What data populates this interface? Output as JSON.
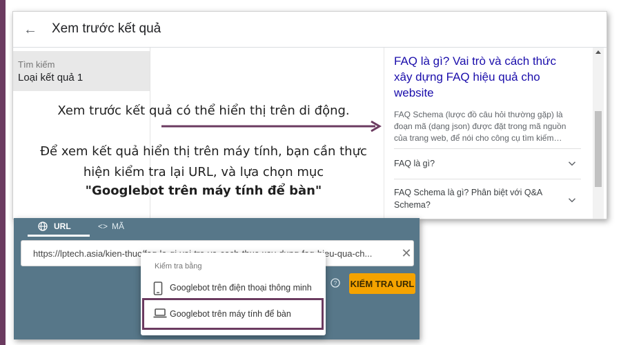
{
  "header": {
    "title": "Xem trước kết quả"
  },
  "sidebar": {
    "label": "Tìm kiếm",
    "value": "Loại kết quả 1"
  },
  "result": {
    "title": "FAQ là gì? Vai trò và cách thức xây dựng FAQ hiệu quả cho website",
    "snippet": "FAQ Schema (lược đồ câu hỏi thường gặp) là đoạn mã (dạng json) được đặt trong mã nguồn của trang web, để nói cho công cụ tìm kiếm…",
    "faqs": [
      "FAQ là gì?",
      "FAQ Schema là gì? Phân biệt với Q&A Schema?"
    ]
  },
  "instructions": {
    "line1": "Xem trước kết quả có thể hiển thị trên di động.",
    "line2": "Để xem kết quả hiển thị trên máy tính, bạn cần thực hiện kiểm tra lại URL, và lựa chọn mục",
    "line3": "\"Googlebot trên máy tính để bàn\""
  },
  "inspect": {
    "tabs": {
      "url": "URL",
      "code": "MÃ"
    },
    "url_value": "https://lptech.asia/kien-thuc/faq-la-gi-vai-tro-va-cach-thuc-xay-dung-faq-hieu-qua-ch...",
    "button": "KIỂM TRA URL"
  },
  "dropdown": {
    "header": "Kiểm tra bằng",
    "options": [
      "Googlebot trên điện thoại thông minh",
      "Googlebot trên máy tính để bàn"
    ],
    "highlighted": "Googlebot trên máy tính để bàn"
  },
  "colors": {
    "accent_purple": "#6b3b60",
    "link_blue": "#1a0dab",
    "panel_teal": "#577789",
    "button_orange": "#f5a300"
  },
  "icons": {
    "back": "arrow-left-icon",
    "chevron": "chevron-down-icon",
    "globe": "globe-icon",
    "code": "code-icon",
    "clear": "close-icon",
    "help": "help-circle-icon",
    "phone": "smartphone-icon",
    "laptop": "laptop-icon"
  }
}
